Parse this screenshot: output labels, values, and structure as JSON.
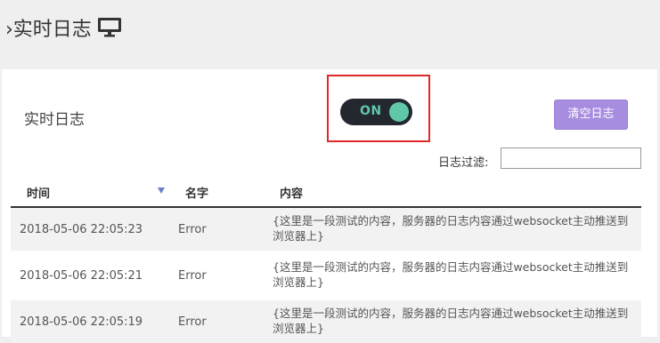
{
  "header": {
    "title": "›实时日志",
    "icon": "monitor-icon"
  },
  "panel": {
    "title": "实时日志",
    "toggle": {
      "label": "ON",
      "state": "on",
      "color": "#5fc8a8"
    },
    "clear_button": "清空日志",
    "filter": {
      "label": "日志过滤:",
      "value": ""
    }
  },
  "table": {
    "columns": [
      "时间",
      "名字",
      "内容"
    ],
    "rows": [
      {
        "time": "2018-05-06 22:05:23",
        "name": "Error",
        "content": "{这里是一段测试的内容，服务器的日志内容通过websocket主动推送到浏览器上}"
      },
      {
        "time": "2018-05-06 22:05:21",
        "name": "Error",
        "content": "{这里是一段测试的内容，服务器的日志内容通过websocket主动推送到浏览器上}"
      },
      {
        "time": "2018-05-06 22:05:19",
        "name": "Error",
        "content": "{这里是一段测试的内容，服务器的日志内容通过websocket主动推送到浏览器上}"
      }
    ]
  }
}
